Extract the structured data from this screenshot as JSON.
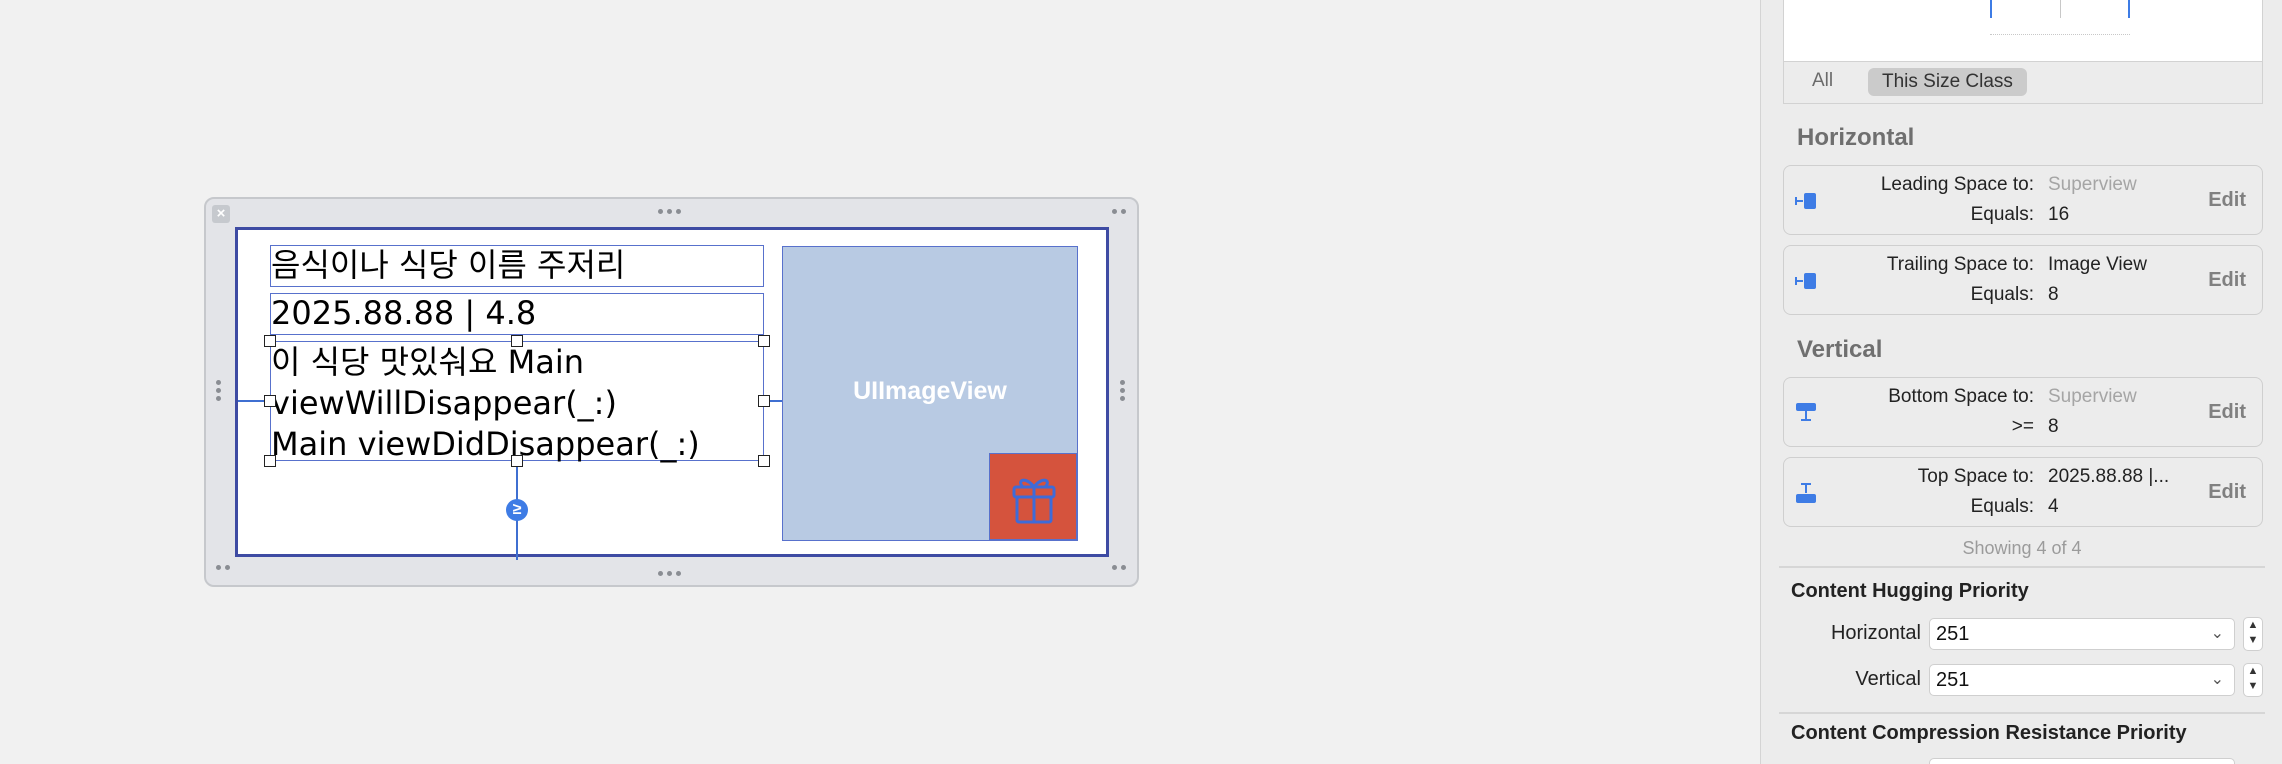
{
  "canvas": {
    "cell": {
      "title_label": "음식이나 식당 이름 주저리",
      "date_label": "2025.88.88 | 4.8",
      "body_label": "이 식당 맛있숴요 Main\nviewWillDisappear(_:)\nMain viewDidDisappear(_:)",
      "constraint_badge": "≥",
      "image_view_label": "UIImageView",
      "gift_icon": "gift-icon"
    }
  },
  "inspector": {
    "size_class": {
      "all_label": "All",
      "this_size_class_label": "This Size Class"
    },
    "horizontal": {
      "heading": "Horizontal",
      "constraints": [
        {
          "k1": "Leading Space to:",
          "v1": "Superview",
          "k2": "Equals:",
          "v2": "16",
          "edit": "Edit",
          "icon": "leading-space-icon"
        },
        {
          "k1": "Trailing Space to:",
          "v1": "Image View",
          "k2": "Equals:",
          "v2": "8",
          "edit": "Edit",
          "icon": "trailing-space-icon"
        }
      ]
    },
    "vertical": {
      "heading": "Vertical",
      "constraints": [
        {
          "k1": "Bottom Space to:",
          "v1": "Superview",
          "k2": ">=",
          "v2": "8",
          "edit": "Edit",
          "icon": "bottom-space-icon"
        },
        {
          "k1": "Top Space to:",
          "v1": "2025.88.88 |...",
          "k2": "Equals:",
          "v2": "4",
          "edit": "Edit",
          "icon": "top-space-icon"
        }
      ]
    },
    "showing": "Showing 4 of 4",
    "hugging": {
      "heading": "Content Hugging Priority",
      "horizontal_label": "Horizontal",
      "horizontal_value": "251",
      "vertical_label": "Vertical",
      "vertical_value": "251"
    },
    "compression": {
      "heading": "Content Compression Resistance Priority"
    }
  }
}
